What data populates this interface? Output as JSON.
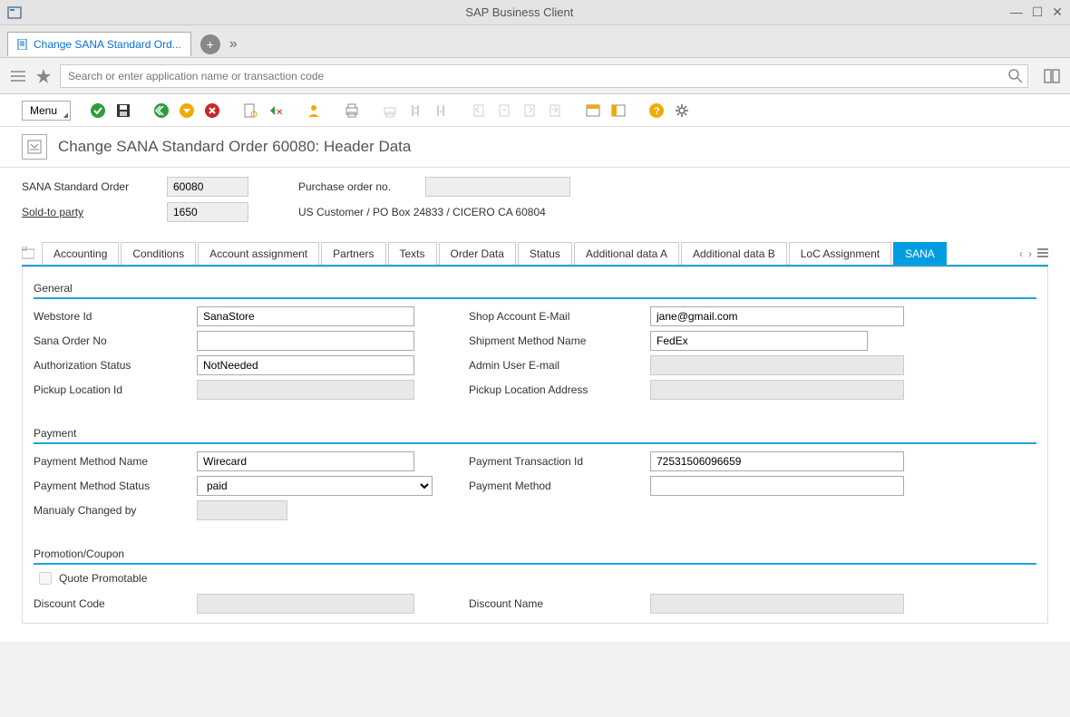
{
  "window": {
    "title": "SAP Business Client"
  },
  "docTab": {
    "label": "Change SANA Standard Ord..."
  },
  "search": {
    "placeholder": "Search or enter application name or transaction code"
  },
  "toolbar": {
    "menu_label": "Menu"
  },
  "page": {
    "title": "Change SANA Standard Order 60080: Header Data"
  },
  "headerFields": {
    "order_type_label": "SANA Standard Order",
    "order_number": "60080",
    "po_label": "Purchase order no.",
    "soldto_label": "Sold-to party",
    "soldto_value": "1650",
    "soldto_text": "US Customer / PO Box 24833 / CICERO CA 60804"
  },
  "tabs": {
    "items": [
      "Accounting",
      "Conditions",
      "Account assignment",
      "Partners",
      "Texts",
      "Order Data",
      "Status",
      "Additional data A",
      "Additional data B",
      "LoC Assignment",
      "SANA"
    ]
  },
  "general": {
    "title": "General",
    "webstore_label": "Webstore Id",
    "webstore_value": "SanaStore",
    "shop_email_label": "Shop Account E-Mail",
    "shop_email_value": "jane@gmail.com",
    "sana_order_label": "Sana Order No",
    "sana_order_value": "",
    "shipment_label": "Shipment Method Name",
    "shipment_value": "FedEx",
    "auth_label": "Authorization Status",
    "auth_value": "NotNeeded",
    "admin_email_label": "Admin User E-mail",
    "admin_email_value": "",
    "pickup_id_label": "Pickup Location Id",
    "pickup_id_value": "",
    "pickup_addr_label": "Pickup Location Address",
    "pickup_addr_value": ""
  },
  "payment": {
    "title": "Payment",
    "method_name_label": "Payment Method Name",
    "method_name_value": "Wirecard",
    "transaction_label": "Payment Transaction Id",
    "transaction_value": "72531506096659",
    "status_label": "Payment Method Status",
    "status_value": "paid",
    "method_label": "Payment Method",
    "method_value": "",
    "changed_label": "Manualy Changed by",
    "changed_value": ""
  },
  "promo": {
    "title": "Promotion/Coupon",
    "quote_label": "Quote Promotable",
    "discount_code_label": "Discount Code",
    "discount_code_value": "",
    "discount_name_label": "Discount Name",
    "discount_name_value": ""
  }
}
